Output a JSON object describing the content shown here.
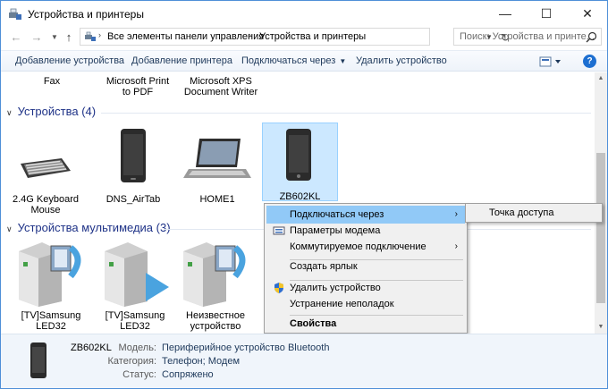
{
  "window": {
    "title": "Устройства и принтеры",
    "controls": {
      "minimize": "—",
      "maximize": "☐",
      "close": "✕"
    }
  },
  "address_bar": {
    "crumbs": [
      "Все элементы панели управления",
      "Устройства и принтеры"
    ],
    "search_placeholder": "Поиск: Устройства и принте..."
  },
  "toolbar": {
    "add_device": "Добавление устройства",
    "add_printer": "Добавление принтера",
    "connect_via": "Подключаться через",
    "remove_device": "Удалить устройство"
  },
  "printers": {
    "items": [
      {
        "label": "Fax"
      },
      {
        "label": "Microsoft Print\nto PDF"
      },
      {
        "label": "Microsoft XPS\nDocument Writer"
      }
    ]
  },
  "devices": {
    "header": "Устройства (4)",
    "items": [
      {
        "label": "2.4G Keyboard\nMouse",
        "icon": "keyboard-icon"
      },
      {
        "label": "DNS_AirTab",
        "icon": "tablet-icon"
      },
      {
        "label": "HOME1",
        "icon": "laptop-icon"
      },
      {
        "label": "ZB602KL",
        "icon": "phone-icon"
      }
    ]
  },
  "multimedia": {
    "header": "Устройства мультимедиа (3)",
    "items": [
      {
        "label": "[TV]Samsung\nLED32",
        "icon": "media-server-icon"
      },
      {
        "label": "[TV]Samsung\nLED32",
        "icon": "media-server-icon"
      },
      {
        "label": "Неизвестное\nустройство",
        "icon": "media-server-icon"
      }
    ]
  },
  "context_menu": {
    "connect_via": "Подключаться через",
    "modem_params": "Параметры модема",
    "dialup": "Коммутируемое подключение",
    "create_shortcut": "Создать ярлык",
    "remove_device": "Удалить устройство",
    "troubleshoot": "Устранение неполадок",
    "properties": "Свойства"
  },
  "submenu": {
    "access_point": "Точка доступа"
  },
  "details": {
    "name": "ZB602KL",
    "rows": [
      {
        "key": "Модель:",
        "value": "Периферийное устройство Bluetooth"
      },
      {
        "key": "Категория:",
        "value": "Телефон; Модем"
      },
      {
        "key": "Статус:",
        "value": "Сопряжено"
      }
    ]
  },
  "colors": {
    "accent": "#1e6fd1",
    "header_text": "#1e3287",
    "selection": "#cce8ff",
    "menu_highlight": "#91c9f7"
  }
}
